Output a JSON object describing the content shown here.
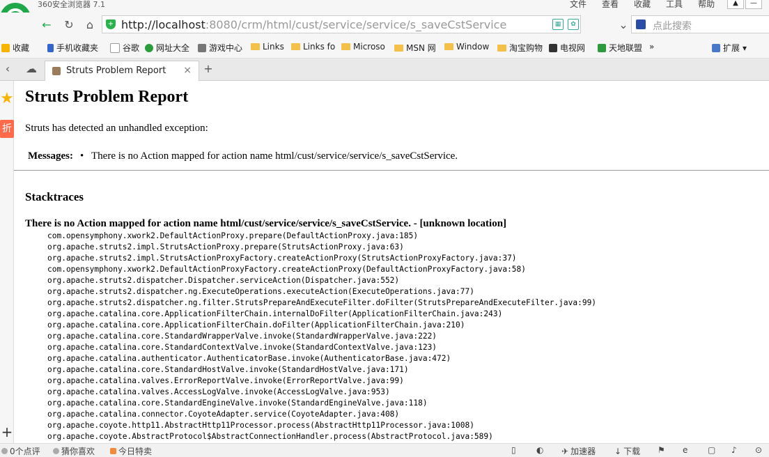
{
  "browser": {
    "app_title": "360安全浏览器 7.1",
    "menu": [
      "文件",
      "查看",
      "收藏",
      "工具",
      "帮助"
    ],
    "url_host": "http://localhost",
    "url_path": ":8080/crm/html/cust/service/service/s_saveCstService",
    "search_placeholder": "点此搜索",
    "bookmarks": [
      "收藏",
      "手机收藏夹",
      "谷歌",
      "网址大全",
      "游戏中心",
      "Links",
      "Links fo",
      "Microso",
      "MSN 网",
      "Window",
      "淘宝购物",
      "电视网",
      "天地联盟"
    ],
    "more_symbol": "»",
    "extensions_label": "扩展",
    "tab_title": "Struts Problem Report",
    "tab_close": "×",
    "new_tab": "+"
  },
  "page": {
    "title": "Struts Problem Report",
    "detected": "Struts has detected an unhandled exception:",
    "messages_label": "Messages:",
    "message": "There is no Action mapped for action name html/cust/service/service/s_saveCstService.",
    "stacktraces_heading": "Stacktraces",
    "trace_heading": "There is no Action mapped for action name html/cust/service/service/s_saveCstService. - [unknown location]",
    "trace_lines": [
      "com.opensymphony.xwork2.DefaultActionProxy.prepare(DefaultActionProxy.java:185)",
      "org.apache.struts2.impl.StrutsActionProxy.prepare(StrutsActionProxy.java:63)",
      "org.apache.struts2.impl.StrutsActionProxyFactory.createActionProxy(StrutsActionProxyFactory.java:37)",
      "com.opensymphony.xwork2.DefaultActionProxyFactory.createActionProxy(DefaultActionProxyFactory.java:58)",
      "org.apache.struts2.dispatcher.Dispatcher.serviceAction(Dispatcher.java:552)",
      "org.apache.struts2.dispatcher.ng.ExecuteOperations.executeAction(ExecuteOperations.java:77)",
      "org.apache.struts2.dispatcher.ng.filter.StrutsPrepareAndExecuteFilter.doFilter(StrutsPrepareAndExecuteFilter.java:99)",
      "org.apache.catalina.core.ApplicationFilterChain.internalDoFilter(ApplicationFilterChain.java:243)",
      "org.apache.catalina.core.ApplicationFilterChain.doFilter(ApplicationFilterChain.java:210)",
      "org.apache.catalina.core.StandardWrapperValve.invoke(StandardWrapperValve.java:222)",
      "org.apache.catalina.core.StandardContextValve.invoke(StandardContextValve.java:123)",
      "org.apache.catalina.authenticator.AuthenticatorBase.invoke(AuthenticatorBase.java:472)",
      "org.apache.catalina.core.StandardHostValve.invoke(StandardHostValve.java:171)",
      "org.apache.catalina.valves.ErrorReportValve.invoke(ErrorReportValve.java:99)",
      "org.apache.catalina.valves.AccessLogValve.invoke(AccessLogValve.java:953)",
      "org.apache.catalina.core.StandardEngineValve.invoke(StandardEngineValve.java:118)",
      "org.apache.catalina.connector.CoyoteAdapter.service(CoyoteAdapter.java:408)",
      "org.apache.coyote.http11.AbstractHttp11Processor.process(AbstractHttp11Processor.java:1008)",
      "org.apache.coyote.AbstractProtocol$AbstractConnectionHandler.process(AbstractProtocol.java:589)"
    ]
  },
  "status": {
    "comments": "0个点评",
    "guess": "猜你喜欢",
    "deals": "今日特卖",
    "accelerator": "加速器",
    "download": "下载"
  },
  "colors": {
    "accent": "#1ea84a",
    "folder": "#f5c04a"
  }
}
